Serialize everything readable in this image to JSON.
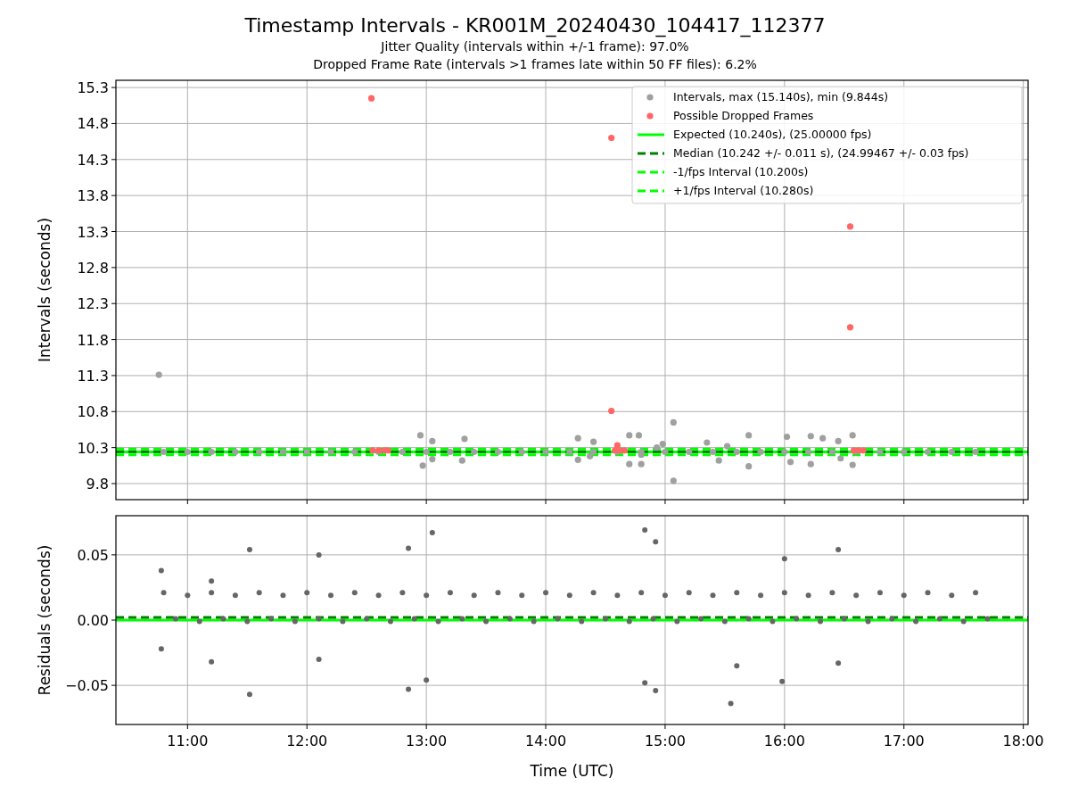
{
  "figure": {
    "title": "Timestamp Intervals - KR001M_20240430_104417_112377",
    "subtitles": [
      "Jitter Quality (intervals within +/-1 frame): 97.0%",
      "Dropped Frame Rate (intervals >1 frames late within 50 FF files): 6.2%"
    ],
    "intervals_plot": {
      "chart_data": {
        "type": "scatter",
        "ylabel": "Intervals (seconds)",
        "grid": true,
        "legend": true,
        "xlim": [
          10.4,
          18.04
        ],
        "ylim": [
          9.577,
          15.4
        ],
        "yticks": [
          9.8,
          10.3,
          10.8,
          11.3,
          11.8,
          12.3,
          12.8,
          13.3,
          13.8,
          14.3,
          14.8,
          15.3
        ],
        "series": [
          {
            "name": "Intervals, max (15.140s), min (9.844s)",
            "color": "#a0a0a0",
            "x": [
              10.8,
              11.0,
              11.2,
              11.4,
              11.6,
              11.8,
              12.0,
              12.2,
              12.4,
              12.6,
              12.8,
              13.0,
              13.2,
              13.4,
              13.6,
              13.8,
              14.0,
              14.2,
              14.4,
              14.6,
              14.8,
              15.0,
              15.2,
              15.4,
              15.6,
              15.8,
              16.0,
              16.2,
              16.4,
              16.6,
              16.8,
              17.0,
              17.2,
              17.4,
              17.6,
              10.76,
              12.95,
              12.97,
              13.05,
              13.05,
              13.32,
              13.3,
              14.27,
              14.27,
              14.37,
              14.4,
              14.7,
              14.7,
              14.78,
              14.8,
              14.8,
              14.93,
              14.98,
              15.07,
              15.07,
              15.35,
              15.45,
              15.52,
              15.7,
              15.7,
              16.02,
              16.05,
              16.22,
              16.22,
              16.32,
              16.45,
              16.47,
              16.57,
              16.57
            ],
            "values": [
              10.24,
              10.24,
              10.24,
              10.24,
              10.24,
              10.24,
              10.24,
              10.24,
              10.24,
              10.24,
              10.24,
              10.24,
              10.24,
              10.24,
              10.24,
              10.24,
              10.24,
              10.24,
              10.24,
              10.24,
              10.24,
              10.24,
              10.24,
              10.24,
              10.24,
              10.24,
              10.24,
              10.24,
              10.24,
              10.24,
              10.24,
              10.24,
              10.24,
              10.24,
              10.24,
              11.31,
              10.47,
              10.05,
              10.14,
              10.39,
              10.42,
              10.12,
              10.43,
              10.13,
              10.18,
              10.38,
              10.47,
              10.07,
              10.47,
              10.07,
              10.2,
              10.3,
              10.35,
              10.65,
              9.84,
              10.37,
              10.12,
              10.32,
              10.47,
              10.04,
              10.45,
              10.1,
              10.46,
              10.07,
              10.43,
              10.39,
              10.15,
              10.47,
              10.06
            ]
          },
          {
            "name": "Possible Dropped Frames",
            "color": "#ff6666",
            "x": [
              12.54,
              14.55,
              14.55,
              16.55,
              16.55,
              14.6,
              12.55,
              12.6,
              12.65,
              12.68,
              14.58,
              14.62,
              14.66,
              16.58,
              16.62,
              16.66
            ],
            "values": [
              15.15,
              14.6,
              10.81,
              13.37,
              11.97,
              10.33,
              10.26,
              10.26,
              10.26,
              10.26,
              10.26,
              10.26,
              10.26,
              10.26,
              10.26,
              10.26
            ]
          },
          {
            "name": "Expected (10.240s), (25.00000 fps)",
            "type": "line",
            "line_style": "solid",
            "color": "#00ff00",
            "x": [
              10.4,
              18.04
            ],
            "values": [
              10.24,
              10.24
            ]
          },
          {
            "name": "Median (10.242 +/- 0.011 s), (24.99467 +/- 0.03 fps)",
            "type": "line",
            "line_style": "dashed",
            "color": "#008000",
            "x": [
              10.4,
              18.04
            ],
            "values": [
              10.242,
              10.242
            ]
          },
          {
            "name": "-1/fps Interval (10.200s)",
            "type": "line",
            "line_style": "dashed",
            "color": "#00ff00",
            "x": [
              10.4,
              18.04
            ],
            "values": [
              10.2,
              10.2
            ]
          },
          {
            "name": "+1/fps Interval (10.280s)",
            "type": "line",
            "line_style": "dashed",
            "color": "#00ff00",
            "x": [
              10.4,
              18.04
            ],
            "values": [
              10.28,
              10.28
            ]
          }
        ]
      }
    },
    "residuals_plot": {
      "chart_data": {
        "type": "scatter",
        "xlabel": "Time (UTC)",
        "ylabel": "Residuals (seconds)",
        "grid": true,
        "xlim": [
          10.4,
          18.04
        ],
        "ylim": [
          -0.08,
          0.08
        ],
        "xticks": [
          {
            "value": 11,
            "label": "11:00"
          },
          {
            "value": 12,
            "label": "12:00"
          },
          {
            "value": 13,
            "label": "13:00"
          },
          {
            "value": 14,
            "label": "14:00"
          },
          {
            "value": 15,
            "label": "15:00"
          },
          {
            "value": 16,
            "label": "16:00"
          },
          {
            "value": 17,
            "label": "17:00"
          },
          {
            "value": 18,
            "label": "18:00"
          }
        ],
        "yticks": [
          {
            "value": 0.05,
            "label": "0.05"
          },
          {
            "value": 0,
            "label": "0.00"
          },
          {
            "value": -0.05,
            "label": "−0.05"
          }
        ],
        "series": [
          {
            "color": "#666666",
            "x": [
              10.8,
              10.9,
              11.0,
              11.1,
              11.2,
              11.3,
              11.4,
              11.5,
              11.6,
              11.7,
              11.8,
              11.9,
              12.0,
              12.1,
              12.2,
              12.3,
              12.4,
              12.5,
              12.6,
              12.7,
              12.8,
              12.9,
              13.0,
              13.1,
              13.2,
              13.3,
              13.4,
              13.5,
              13.6,
              13.7,
              13.8,
              13.9,
              14.0,
              14.1,
              14.2,
              14.3,
              14.4,
              14.5,
              14.6,
              14.7,
              14.8,
              14.9,
              15.0,
              15.1,
              15.2,
              15.3,
              15.4,
              15.5,
              15.6,
              15.7,
              15.8,
              15.9,
              16.0,
              16.1,
              16.2,
              16.3,
              16.4,
              16.5,
              16.6,
              16.7,
              16.8,
              16.9,
              17.0,
              17.1,
              17.2,
              17.3,
              17.4,
              17.5,
              17.6,
              17.7,
              11.52,
              11.52,
              12.1,
              12.1,
              12.85,
              12.85,
              13.05,
              13.0,
              14.83,
              14.83,
              14.92,
              14.92,
              15.55,
              15.6,
              15.98,
              16.0,
              16.45,
              16.45,
              10.78,
              10.78,
              11.2,
              11.2
            ],
            "values": [
              0.021,
              0.001,
              0.019,
              -0.001,
              0.021,
              0.001,
              0.019,
              -0.001,
              0.021,
              0.001,
              0.019,
              -0.001,
              0.021,
              0.001,
              0.019,
              -0.001,
              0.021,
              0.001,
              0.019,
              -0.001,
              0.021,
              0.001,
              0.019,
              -0.001,
              0.021,
              0.001,
              0.019,
              -0.001,
              0.021,
              0.001,
              0.019,
              -0.001,
              0.021,
              0.001,
              0.019,
              -0.001,
              0.021,
              0.001,
              0.019,
              -0.001,
              0.021,
              0.001,
              0.019,
              -0.001,
              0.021,
              0.001,
              0.019,
              -0.001,
              0.021,
              0.001,
              0.019,
              -0.001,
              0.021,
              0.001,
              0.019,
              -0.001,
              0.021,
              0.001,
              0.019,
              -0.001,
              0.021,
              0.001,
              0.019,
              -0.001,
              0.021,
              0.001,
              0.019,
              -0.001,
              0.021,
              0.001,
              0.054,
              -0.057,
              0.05,
              -0.03,
              0.055,
              -0.053,
              0.067,
              -0.046,
              0.069,
              -0.048,
              -0.054,
              0.06,
              -0.064,
              -0.035,
              -0.047,
              0.047,
              0.054,
              -0.033,
              0.038,
              -0.022,
              0.03,
              -0.032
            ]
          },
          {
            "type": "line",
            "line_style": "solid",
            "color": "#00ff00",
            "x": [
              10.4,
              18.04
            ],
            "values": [
              0,
              0
            ]
          },
          {
            "type": "line",
            "line_style": "dashed",
            "color": "#008000",
            "x": [
              10.4,
              18.04
            ],
            "values": [
              0.002,
              0.002
            ]
          }
        ]
      }
    }
  }
}
